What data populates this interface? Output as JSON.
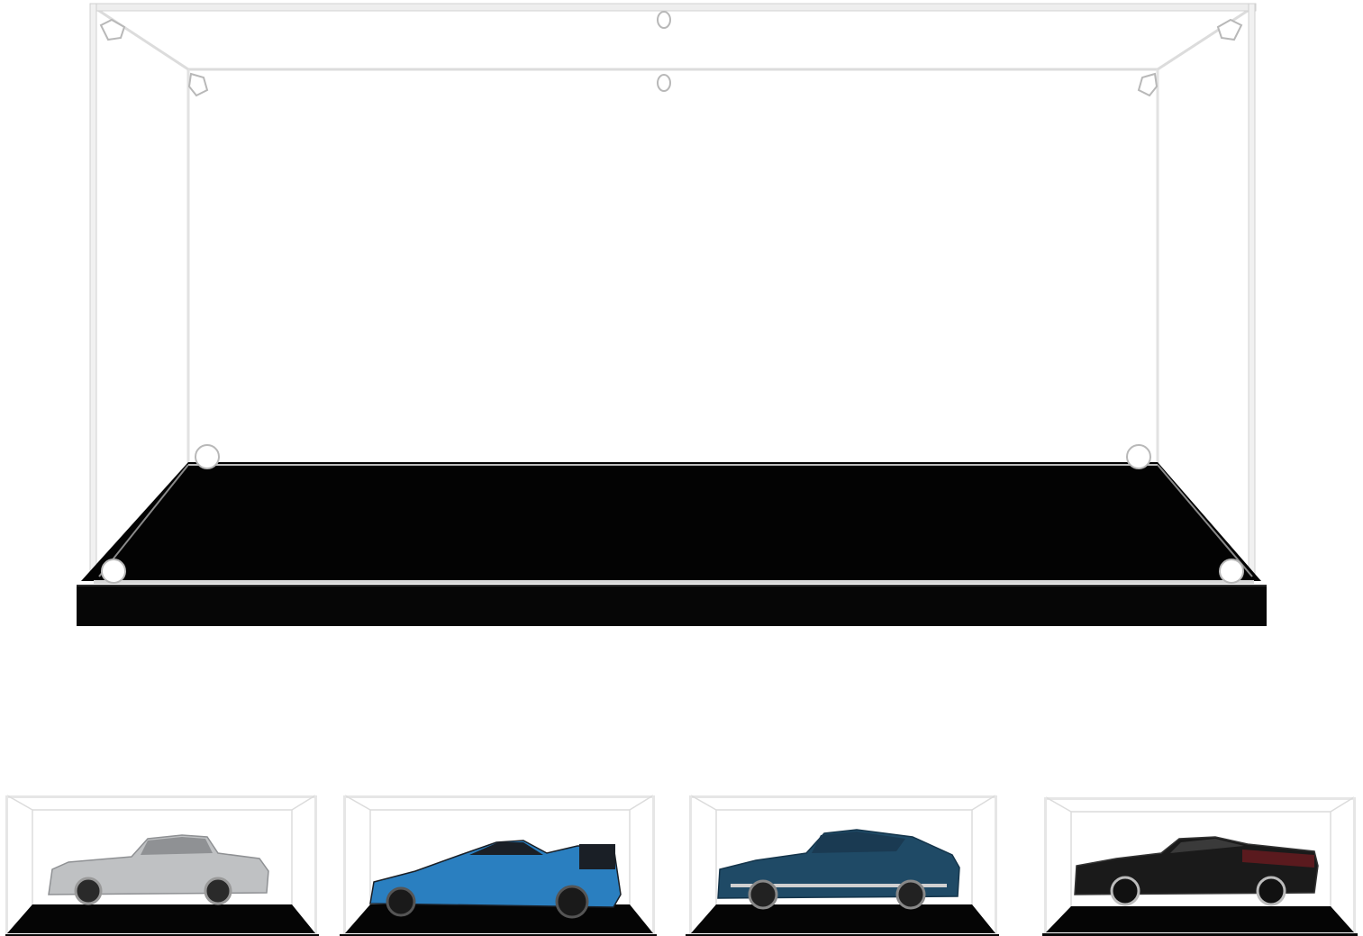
{
  "colors": {
    "background": "#ffffff",
    "base": "#050505",
    "base_edge": "#1a1a1a",
    "acrylic_edge": "#d9d9d9",
    "acrylic_edge_light": "#eeeeee",
    "hardware": "#cfcfcf"
  },
  "product": {
    "name_icon": "acrylic-display-case-icon"
  },
  "thumbnails": [
    {
      "model": "silver-classic-coupe",
      "body_color": "#bfc1c3",
      "roof_color": "#8f9194"
    },
    {
      "model": "blue-race-car",
      "body_color": "#2a7fc0",
      "roof_color": "#1a1f26"
    },
    {
      "model": "navy-fastback",
      "body_color": "#1f4a66",
      "roof_color": "#1a3a52"
    },
    {
      "model": "black-muscle-car",
      "body_color": "#1a1a1a",
      "roof_color": "#111111"
    }
  ]
}
